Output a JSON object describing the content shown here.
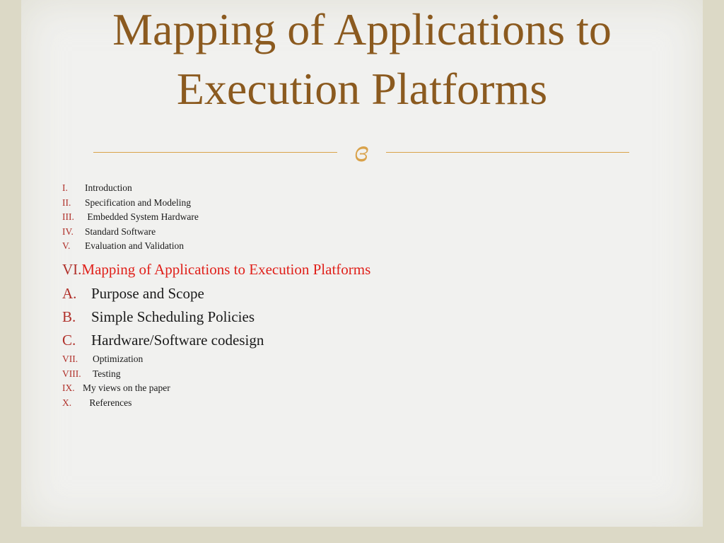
{
  "slide": {
    "title_line1": "Mapping of Applications to",
    "title_line2": "Execution Platforms",
    "ornament_glyph": "ɞ",
    "accent_color": "#d9a24a",
    "title_color": "#8b5a1f",
    "numeral_color": "#b0302a",
    "highlight_color": "#e0201a"
  },
  "outline": {
    "items": [
      {
        "num": "I.",
        "label": "Introduction"
      },
      {
        "num": "II.",
        "label": "Specification and Modeling"
      },
      {
        "num": "III.",
        "label": " Embedded System Hardware"
      },
      {
        "num": "IV.",
        "label": "Standard Software"
      },
      {
        "num": "V.",
        "label": "Evaluation and Validation"
      }
    ],
    "current": {
      "num": "VI.",
      "label": "Mapping of Applications to Execution Platforms"
    },
    "subitems": [
      {
        "num": "A.",
        "label": "Purpose and Scope"
      },
      {
        "num": "B.",
        "label": "Simple Scheduling Policies"
      },
      {
        "num": "C.",
        "label": "Hardware/Software codesign"
      }
    ],
    "rest": [
      {
        "num": "VII.",
        "label": "Optimization"
      },
      {
        "num": "VIII.",
        "label": "Testing"
      },
      {
        "num": "IX.",
        "label": "My views on the paper"
      },
      {
        "num": "X.",
        "label": " References"
      }
    ]
  }
}
